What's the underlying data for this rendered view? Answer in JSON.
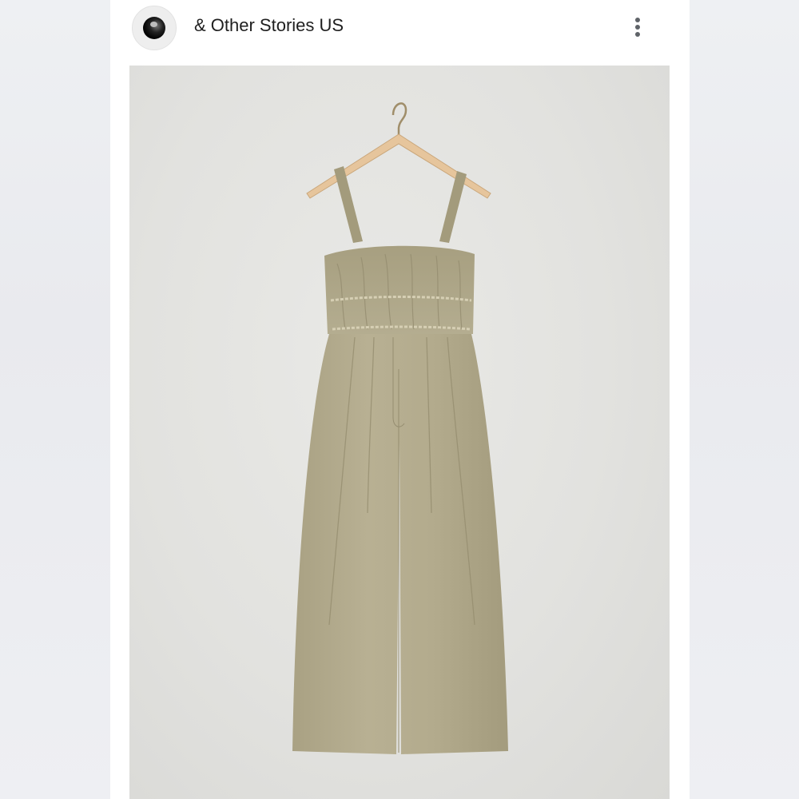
{
  "store": {
    "name": "& Other Stories US",
    "avatar_icon": "store-logo-avatar",
    "menu_icon": "more-vertical-icon"
  },
  "product": {
    "image_icon": "jumpsuit-on-hanger-photo",
    "colors": {
      "fabric": "#b2aa8b",
      "background": "#e4e4e1",
      "hanger": "#e6c59c"
    }
  }
}
